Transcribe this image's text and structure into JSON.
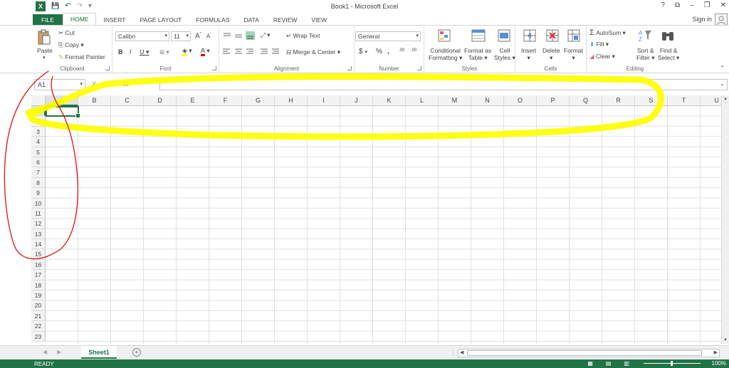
{
  "window": {
    "app_letter": "X",
    "title": "Book1 - Microsoft Excel",
    "help": "?",
    "restore_ribbon": "⧉",
    "minimize": "–",
    "maximize": "❐",
    "close": "✕",
    "qat": {
      "save": "💾",
      "undo": "↶",
      "redo": "↷",
      "customize": "▾"
    }
  },
  "tabs": [
    "FILE",
    "HOME",
    "INSERT",
    "PAGE LAYOUT",
    "FORMULAS",
    "DATA",
    "REVIEW",
    "VIEW"
  ],
  "active_tab": "HOME",
  "signin": "Sign in",
  "ribbon": {
    "clipboard": {
      "label": "Clipboard",
      "paste": "Paste",
      "cut": "Cut",
      "copy": "Copy",
      "format_painter": "Format Painter"
    },
    "font": {
      "label": "Font",
      "name": "Calibri",
      "size": "11",
      "grow": "A",
      "shrink": "A",
      "bold": "B",
      "italic": "I",
      "underline": "U"
    },
    "alignment": {
      "label": "Alignment",
      "wrap": "Wrap Text",
      "merge": "Merge & Center"
    },
    "number": {
      "label": "Number",
      "format": "General",
      "currency": "$",
      "percent": "%",
      "comma": ",",
      "inc_dec": ".00",
      "dec_dec": ".00"
    },
    "styles": {
      "label": "Styles",
      "conditional": "Conditional",
      "conditional2": "Formatting",
      "format_table": "Format as",
      "format_table2": "Table",
      "cell_styles": "Cell",
      "cell_styles2": "Styles"
    },
    "cells": {
      "label": "Cells",
      "insert": "Insert",
      "delete": "Delete",
      "format": "Format"
    },
    "editing": {
      "label": "Editing",
      "autosum": "AutoSum",
      "fill": "Fill",
      "clear": "Clear",
      "sort": "Sort &",
      "sort2": "Filter",
      "find": "Find &",
      "find2": "Select"
    }
  },
  "formula_bar": {
    "name_box": "A1",
    "cancel": "✕",
    "enter": "✓",
    "fx": "fx",
    "value": ""
  },
  "columns": [
    "A",
    "B",
    "C",
    "D",
    "E",
    "F",
    "G",
    "H",
    "I",
    "J",
    "K",
    "L",
    "M",
    "N",
    "O",
    "P",
    "Q",
    "R",
    "S",
    "T",
    "U"
  ],
  "rows": [
    "1",
    "2",
    "3",
    "4",
    "5",
    "6",
    "7",
    "8",
    "9",
    "10",
    "11",
    "12",
    "13",
    "14",
    "15",
    "16",
    "17",
    "18",
    "19",
    "20",
    "21",
    "22",
    "23"
  ],
  "selected_cell": {
    "col": "A",
    "row": "1"
  },
  "sheets": [
    "Sheet1"
  ],
  "status": {
    "ready": "READY",
    "zoom": "100%"
  },
  "colors": {
    "accent": "#217346",
    "highlighter": "#ffff00",
    "pen": "#dd1111"
  }
}
